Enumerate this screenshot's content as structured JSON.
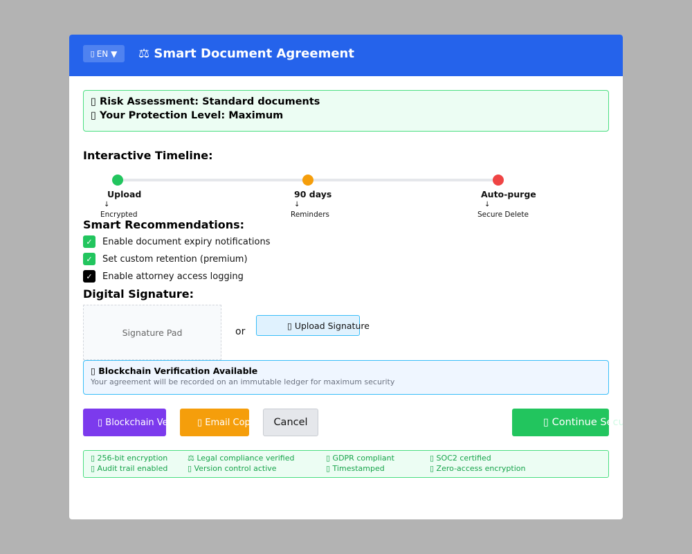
{
  "colors": {
    "overlay": "#b3b3b3",
    "header": "#2563eb",
    "timeline_upload": "#22c55e",
    "timeline_90": "#f59e0b",
    "timeline_purge": "#ef4444",
    "checkbox_checked": "#22c55e",
    "checkbox_dark": "#000000",
    "btn_blockchain": "#7c3aed",
    "btn_email": "#f59e0b",
    "btn_continue": "#22c55e"
  },
  "header": {
    "lang_icon": "globe-icon",
    "lang_glyph": "▯",
    "lang_label": "EN ▼",
    "title": "⚖ Smart Document Agreement"
  },
  "risk": {
    "assessment": "▯ Risk Assessment: Standard documents",
    "protection": "▯ Your Protection Level: Maximum"
  },
  "timeline": {
    "title": "Interactive Timeline:",
    "steps": [
      {
        "label": "Upload",
        "arrow": "↓",
        "sub": "Encrypted"
      },
      {
        "label": "90 days",
        "arrow": "↓",
        "sub": "Reminders"
      },
      {
        "label": "Auto-purge",
        "arrow": "↓",
        "sub": "Secure Delete"
      }
    ]
  },
  "recommendations": {
    "title": "Smart Recommendations:",
    "items": [
      {
        "label": "Enable document expiry notifications",
        "check": "✓",
        "checked": true
      },
      {
        "label": "Set custom retention (premium)",
        "check": "✓",
        "checked": true
      },
      {
        "label": "Enable attorney access logging",
        "check": "✓",
        "checked": true
      }
    ]
  },
  "signature": {
    "title": "Digital Signature:",
    "pad_label": "Signature Pad",
    "or": "or",
    "upload_label": "▯ Upload Signature"
  },
  "blockchain": {
    "title": "▯ Blockchain Verification Available",
    "description": "Your agreement will be recorded on an immutable ledger for maximum security"
  },
  "actions": {
    "blockchain": "▯ Blockchain Ver",
    "email": "▯ Email Copy",
    "cancel": "Cancel",
    "continue": "▯ Continue Se",
    "continue_overflow": "cure"
  },
  "trust": {
    "items": [
      "▯ 256-bit encryption",
      "⚖ Legal compliance verified",
      "▯ GDPR compliant",
      "▯ SOC2 certified",
      "▯ Audit trail enabled",
      "▯ Version control active",
      "▯ Timestamped",
      "▯ Zero-access encryption"
    ]
  }
}
